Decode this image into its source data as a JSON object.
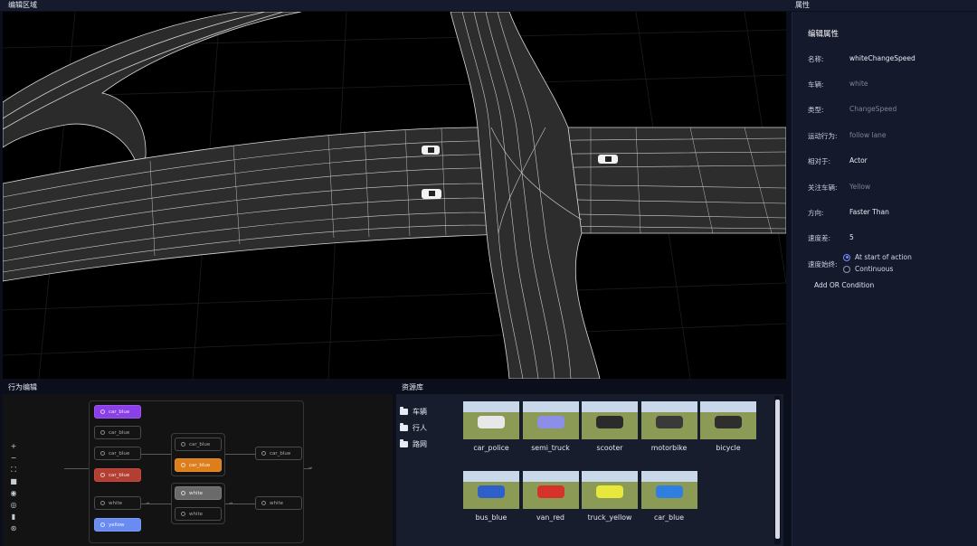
{
  "panels": {
    "edit_area": "编辑区域",
    "properties": "属性",
    "behavior_editor": "行为编辑",
    "resource_library": "资源库"
  },
  "properties": {
    "heading": "编辑属性",
    "rows": [
      {
        "label": "名称:",
        "value": "whiteChangeSpeed"
      },
      {
        "label": "车辆:",
        "value": "white"
      },
      {
        "label": "类型:",
        "value": "ChangeSpeed"
      },
      {
        "label": "运动行为:",
        "value": "follow lane"
      },
      {
        "label": "相对于:",
        "value": "Actor"
      },
      {
        "label": "关注车辆:",
        "value": "Yellow"
      },
      {
        "label": "方向:",
        "value": "Faster Than"
      },
      {
        "label": "速度差:",
        "value": "5"
      }
    ],
    "speed_start": {
      "label": "速度始终:",
      "options": [
        "At start of action",
        "Continuous"
      ],
      "selected": "At start of action"
    },
    "add_or_condition": "Add OR Condition"
  },
  "behavior_editor": {
    "tools": [
      "+",
      "−",
      "⛶",
      "■",
      "◉",
      "◎",
      "▮",
      "⊛"
    ],
    "nodes": [
      {
        "label": "car_blue",
        "color": "#8b3fe6"
      },
      {
        "label": "car_blue"
      },
      {
        "label": "car_blue"
      },
      {
        "label": "car_blue",
        "color": "#b33f34"
      },
      {
        "label": "white"
      },
      {
        "label": "yellow",
        "color": "#6a8cf2"
      },
      {
        "label": "car_blue"
      },
      {
        "label": "car_blue",
        "color": "#dd7e1d"
      },
      {
        "label": "white",
        "color": "#6a6a6a"
      },
      {
        "label": "white"
      },
      {
        "label": "car_blue"
      },
      {
        "label": "white"
      }
    ]
  },
  "library": {
    "tree": [
      "车辆",
      "行人",
      "路网"
    ],
    "assets": [
      {
        "name": "car_police",
        "color": "#e8e8e8"
      },
      {
        "name": "semi_truck",
        "color": "#8c8ee8"
      },
      {
        "name": "scooter",
        "color": "#2b2b2b"
      },
      {
        "name": "motorbike",
        "color": "#3a3a3a"
      },
      {
        "name": "bicycle",
        "color": "#2e2e2e"
      },
      {
        "name": "bus_blue",
        "color": "#2f5fc8"
      },
      {
        "name": "van_red",
        "color": "#d4322a"
      },
      {
        "name": "truck_yellow",
        "color": "#e7e83b"
      },
      {
        "name": "car_blue",
        "color": "#2f7ee0"
      }
    ]
  }
}
